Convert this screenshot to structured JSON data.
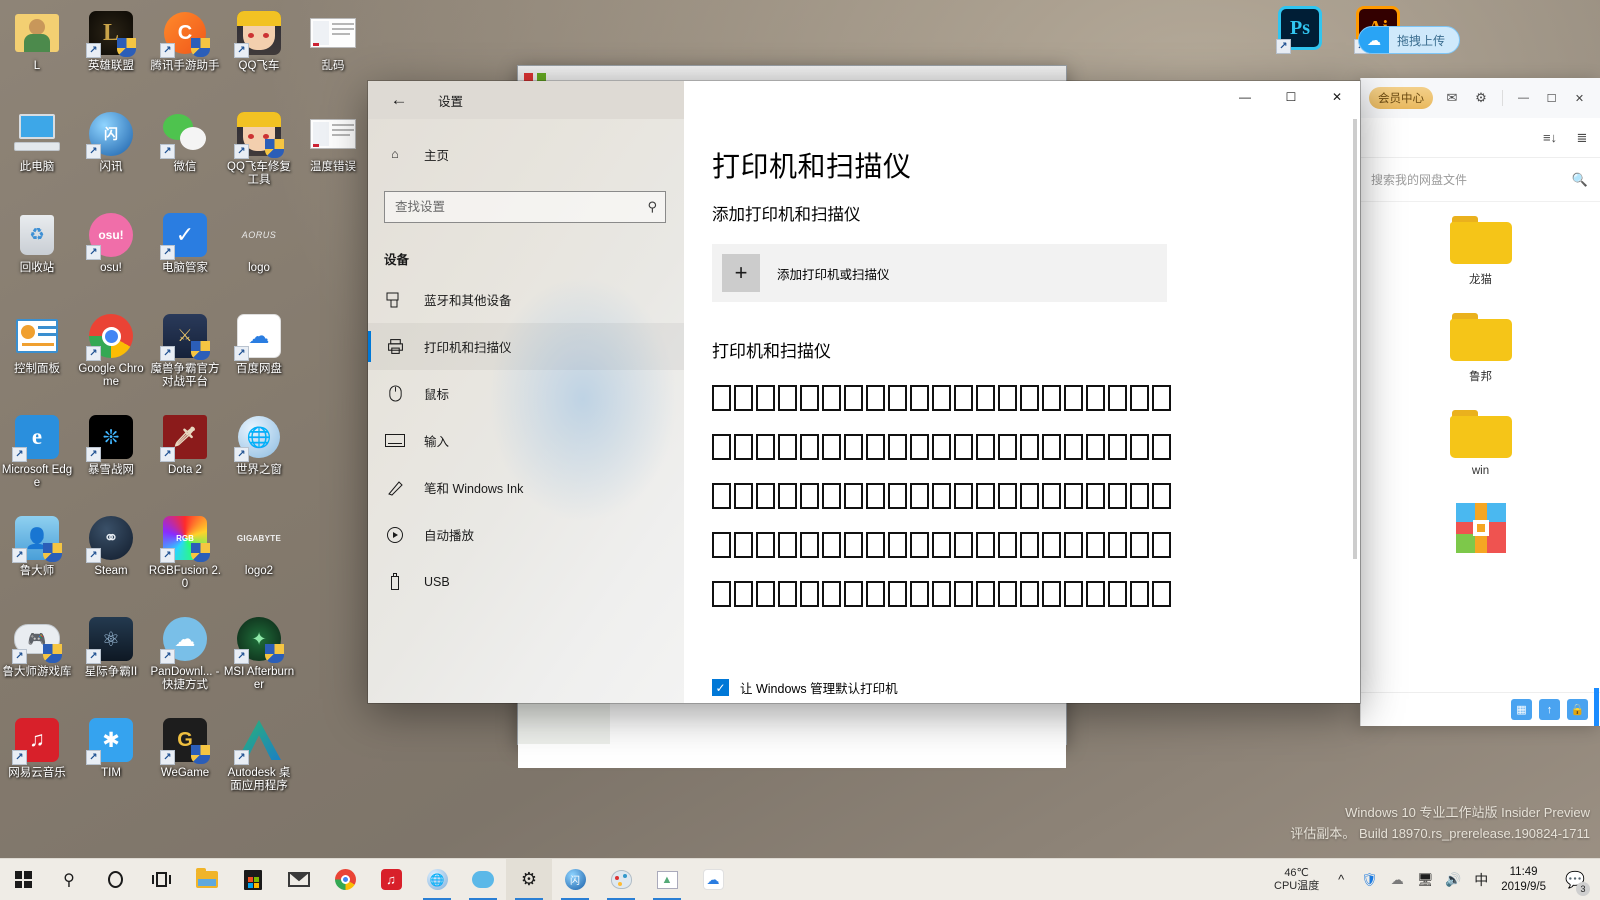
{
  "desktop": {
    "icons": [
      {
        "label": "L",
        "kind": "folder-user",
        "shortcut": false
      },
      {
        "label": "英雄联盟",
        "kind": "lol",
        "shortcut": true
      },
      {
        "label": "腾讯手游助手",
        "kind": "tencent-gamebuddy",
        "shortcut": true
      },
      {
        "label": "QQ飞车",
        "kind": "qqspeed",
        "shortcut": true
      },
      {
        "label": "乱码",
        "kind": "screenshot-doc",
        "shortcut": false
      },
      {
        "label": "此电脑",
        "kind": "this-pc",
        "shortcut": false
      },
      {
        "label": "闪讯",
        "kind": "shanxun",
        "shortcut": true
      },
      {
        "label": "微信",
        "kind": "wechat",
        "shortcut": true
      },
      {
        "label": "QQ飞车修复工具",
        "kind": "qqspeed-fix",
        "shortcut": true
      },
      {
        "label": "温度错误",
        "kind": "screenshot-doc",
        "shortcut": false
      },
      {
        "label": "回收站",
        "kind": "recycle-bin",
        "shortcut": false
      },
      {
        "label": "osu!",
        "kind": "osu",
        "shortcut": true
      },
      {
        "label": "电脑管家",
        "kind": "pc-manager",
        "shortcut": true
      },
      {
        "label": "logo",
        "kind": "aorus-logo",
        "shortcut": false
      },
      {
        "label": "",
        "kind": "blank",
        "shortcut": false
      },
      {
        "label": "控制面板",
        "kind": "control-panel",
        "shortcut": false
      },
      {
        "label": "Google Chrome",
        "kind": "chrome",
        "shortcut": true
      },
      {
        "label": "魔兽争霸官方对战平台",
        "kind": "warcraft-platform",
        "shortcut": true
      },
      {
        "label": "百度网盘",
        "kind": "baidu-netdisk",
        "shortcut": true
      },
      {
        "label": "",
        "kind": "blank",
        "shortcut": false
      },
      {
        "label": "Microsoft Edge",
        "kind": "edge",
        "shortcut": true
      },
      {
        "label": "暴雪战网",
        "kind": "battlenet",
        "shortcut": true
      },
      {
        "label": "Dota 2",
        "kind": "dota2",
        "shortcut": true
      },
      {
        "label": "世界之窗",
        "kind": "theworld",
        "shortcut": true
      },
      {
        "label": "",
        "kind": "blank",
        "shortcut": false
      },
      {
        "label": "鲁大师",
        "kind": "ludashi",
        "shortcut": true
      },
      {
        "label": "Steam",
        "kind": "steam",
        "shortcut": true
      },
      {
        "label": "RGBFusion 2.0",
        "kind": "rgbfusion",
        "shortcut": true
      },
      {
        "label": "logo2",
        "kind": "gigabyte-logo",
        "shortcut": false
      },
      {
        "label": "",
        "kind": "blank",
        "shortcut": false
      },
      {
        "label": "鲁大师游戏库",
        "kind": "ludashi-games",
        "shortcut": true
      },
      {
        "label": "星际争霸II",
        "kind": "starcraft2",
        "shortcut": true
      },
      {
        "label": "PanDownl... - 快捷方式",
        "kind": "pandownload",
        "shortcut": true
      },
      {
        "label": "MSI Afterburner",
        "kind": "msi-afterburner",
        "shortcut": true
      },
      {
        "label": "",
        "kind": "blank",
        "shortcut": false
      },
      {
        "label": "网易云音乐",
        "kind": "netease-music",
        "shortcut": true
      },
      {
        "label": "TIM",
        "kind": "tim",
        "shortcut": true
      },
      {
        "label": "WeGame",
        "kind": "wegame",
        "shortcut": true
      },
      {
        "label": "Autodesk 桌面应用程序",
        "kind": "autodesk",
        "shortcut": true
      },
      {
        "label": "",
        "kind": "blank",
        "shortcut": false
      }
    ],
    "top_right_icons": [
      {
        "label": "Ps",
        "kind": "photoshop"
      },
      {
        "label": "Ai",
        "kind": "illustrator"
      }
    ],
    "drag_upload": {
      "label": "拖拽上传",
      "icon": "baidu-cloud-icon"
    },
    "watermark": {
      "line1": "Windows 10 专业工作站版 Insider Preview",
      "line2": "评估副本。  Build 18970.rs_prerelease.190824-1711"
    }
  },
  "settings_window": {
    "titlebar": {
      "back_icon": "back-arrow-icon",
      "title": "设置",
      "minimize": "—",
      "maximize": "☐",
      "close": "✕"
    },
    "nav": {
      "home_label": "主页",
      "home_icon": "home-icon",
      "search": {
        "placeholder": "查找设置",
        "value": "",
        "icon": "search-icon"
      },
      "group_label": "设备",
      "items": [
        {
          "label": "蓝牙和其他设备",
          "icon": "bluetooth-device-icon",
          "active": false
        },
        {
          "label": "打印机和扫描仪",
          "icon": "printer-icon",
          "active": true
        },
        {
          "label": "鼠标",
          "icon": "mouse-icon",
          "active": false
        },
        {
          "label": "输入",
          "icon": "keyboard-icon",
          "active": false
        },
        {
          "label": "笔和 Windows Ink",
          "icon": "pen-icon",
          "active": false
        },
        {
          "label": "自动播放",
          "icon": "autoplay-icon",
          "active": false
        },
        {
          "label": "USB",
          "icon": "usb-icon",
          "active": false
        }
      ]
    },
    "main": {
      "page_title": "打印机和扫描仪",
      "add_section_title": "添加打印机和扫描仪",
      "add_tile_label": "添加打印机或扫描仪",
      "add_tile_icon": "plus-icon",
      "list_section_title": "打印机和扫描仪",
      "printer_rows": [
        {
          "glyph_count": 21,
          "note": "missing-glyph"
        },
        {
          "glyph_count": 21,
          "note": "missing-glyph"
        },
        {
          "glyph_count": 21,
          "note": "missing-glyph"
        },
        {
          "glyph_count": 21,
          "note": "missing-glyph"
        },
        {
          "glyph_count": 21,
          "note": "missing-glyph"
        }
      ],
      "checkbox": {
        "label": "让 Windows 管理默认打印机",
        "checked": true,
        "mark": "✓"
      }
    }
  },
  "baidu_window": {
    "titlebar": {
      "vip_label": "会员中心",
      "mail_icon": "mail-icon",
      "settings_icon": "gear-icon",
      "minimize": "—",
      "maximize": "☐",
      "close": "✕"
    },
    "toolbar": {
      "sort_icon": "sort-icon",
      "view_icon": "list-view-icon"
    },
    "search": {
      "placeholder": "搜索我的网盘文件",
      "value": "",
      "icon": "search-icon"
    },
    "files": [
      {
        "name": "龙猫",
        "kind": "folder"
      },
      {
        "name": "鲁邦",
        "kind": "folder"
      },
      {
        "name": "win",
        "kind": "folder"
      },
      {
        "name": "",
        "kind": "gift-box"
      }
    ]
  },
  "taskbar": {
    "items": [
      {
        "name": "start-button",
        "icon": "windows-logo-icon",
        "running": false,
        "active": false
      },
      {
        "name": "search-button",
        "icon": "search-icon",
        "running": false,
        "active": false
      },
      {
        "name": "cortana-button",
        "icon": "cortana-circle-icon",
        "running": false,
        "active": false
      },
      {
        "name": "task-view-button",
        "icon": "task-view-icon",
        "running": false,
        "active": false
      },
      {
        "name": "file-explorer",
        "icon": "folder-icon",
        "running": false,
        "active": false
      },
      {
        "name": "microsoft-store",
        "icon": "store-bag-icon",
        "running": false,
        "active": false
      },
      {
        "name": "mail",
        "icon": "mail-icon",
        "running": false,
        "active": false
      },
      {
        "name": "chrome",
        "icon": "chrome-icon",
        "running": false,
        "active": false
      },
      {
        "name": "netease-music",
        "icon": "netease-icon",
        "running": false,
        "active": false
      },
      {
        "name": "theworld-browser",
        "icon": "globe-icon",
        "running": true,
        "active": false
      },
      {
        "name": "baidu-netdisk",
        "icon": "cloud-icon",
        "running": true,
        "active": false
      },
      {
        "name": "settings",
        "icon": "gear-icon",
        "running": true,
        "active": true
      },
      {
        "name": "shanxun",
        "icon": "shanxun-icon",
        "running": true,
        "active": false
      },
      {
        "name": "paint",
        "icon": "paint-palette-icon",
        "running": true,
        "active": false
      },
      {
        "name": "photos",
        "icon": "photos-icon",
        "running": true,
        "active": false
      },
      {
        "name": "baidu-cloud",
        "icon": "baidu-cloud-icon",
        "running": false,
        "active": false
      }
    ],
    "cpu_widget": {
      "temp": "46℃",
      "label": "CPU温度"
    },
    "tray": {
      "chevron": "show-hidden-icons",
      "icons": [
        "pc-manager-shield-icon",
        "onedrive-cloud-icon",
        "network-icon",
        "volume-icon"
      ],
      "ime": "中"
    },
    "clock": {
      "time": "11:49",
      "date": "2019/9/5"
    },
    "notification": {
      "icon": "action-center-icon",
      "count": "3"
    }
  }
}
